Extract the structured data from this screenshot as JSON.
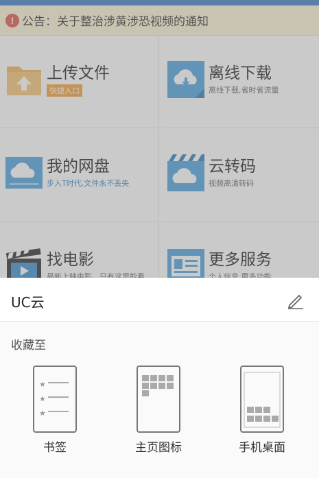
{
  "notice": {
    "icon": "exclamation-icon",
    "text": "公告：关于整治涉黄涉恐视频的通知"
  },
  "grid": [
    {
      "title": "上传文件",
      "sub": "快捷入口",
      "icon": "folder-upload-icon"
    },
    {
      "title": "离线下载",
      "sub": "离线下载,省时省流量",
      "icon": "cloud-download-icon"
    },
    {
      "title": "我的网盘",
      "sub": "步入T时代,文件永不丢失",
      "icon": "cloud-drive-icon"
    },
    {
      "title": "云转码",
      "sub": "视频高清转码",
      "icon": "cloud-transcode-icon"
    },
    {
      "title": "找电影",
      "sub": "最新上映电影，只有这里能看",
      "icon": "film-clapper-icon"
    },
    {
      "title": "更多服务",
      "sub": "个人信息,更多功能",
      "icon": "id-card-icon"
    }
  ],
  "sheet": {
    "title": "UC云",
    "subtitle": "收藏至",
    "options": [
      {
        "label": "书签",
        "icon": "bookmark-list-icon"
      },
      {
        "label": "主页图标",
        "icon": "homepage-grid-icon"
      },
      {
        "label": "手机桌面",
        "icon": "phone-desktop-icon"
      }
    ]
  },
  "colors": {
    "accent": "#3d7fc6",
    "notice_bg": "#fdf3d6",
    "badge": "#f3a33a"
  }
}
